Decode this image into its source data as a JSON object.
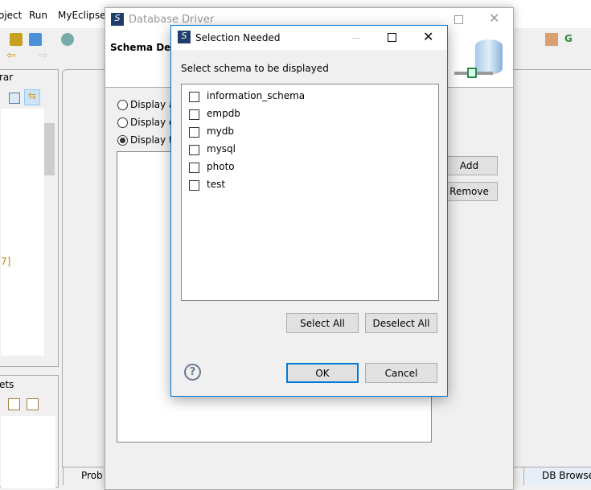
{
  "eclipse": {
    "menu": [
      "oject",
      "Run",
      "MyEclipse"
    ],
    "left_tab_top": "rar",
    "left_tab_bottom": "ets",
    "tree_fragment": "7]",
    "bottom_tabs": [
      "Prob",
      "DB Browse"
    ]
  },
  "driver_window": {
    "title": "Database Driver",
    "header": "Schema Deta",
    "radios": [
      {
        "label": "Display a",
        "checked": false
      },
      {
        "label": "Display c",
        "checked": false
      },
      {
        "label": "Display t",
        "checked": true
      }
    ],
    "add_label": "Add",
    "remove_label": "Remove"
  },
  "dialog": {
    "title": "Selection Needed",
    "prompt": "Select schema to be displayed",
    "schemas": [
      {
        "name": "information_schema",
        "checked": false
      },
      {
        "name": "empdb",
        "checked": false
      },
      {
        "name": "mydb",
        "checked": false
      },
      {
        "name": "mysql",
        "checked": false
      },
      {
        "name": "photo",
        "checked": false
      },
      {
        "name": "test",
        "checked": false
      }
    ],
    "select_all": "Select All",
    "deselect_all": "Deselect All",
    "ok": "OK",
    "cancel": "Cancel",
    "accent": "#0078d7"
  }
}
